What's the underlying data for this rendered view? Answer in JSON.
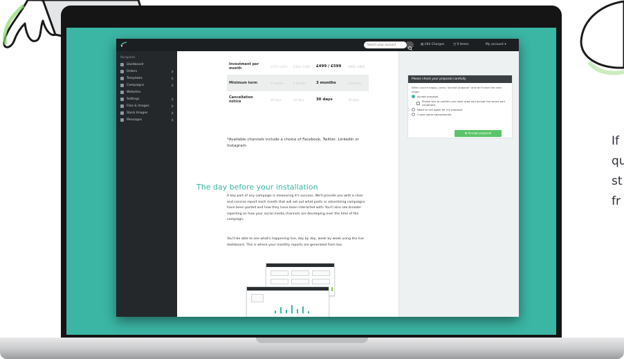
{
  "topbar": {
    "search_placeholder": "Search your account",
    "links": [
      "£94 Charges",
      "0 Items",
      "My account"
    ]
  },
  "sidebar": {
    "heading": "Navigation",
    "items": [
      {
        "label": "Dashboard",
        "has_submenu": false
      },
      {
        "label": "Orders",
        "has_submenu": true
      },
      {
        "label": "Templates",
        "has_submenu": true
      },
      {
        "label": "Campaigns",
        "has_submenu": true
      },
      {
        "label": "Websites",
        "has_submenu": false
      },
      {
        "label": "Settings",
        "has_submenu": true
      },
      {
        "label": "Files & Images",
        "has_submenu": true
      },
      {
        "label": "Stock Images",
        "has_submenu": true
      },
      {
        "label": "Messages",
        "has_submenu": true
      }
    ]
  },
  "pricing_table": {
    "rows": [
      {
        "label": "Investment per month",
        "cells": [
          "£175 / £225",
          "£350 / £450",
          "£499 / £599",
          "£600 / £800"
        ]
      },
      {
        "label": "Minimum term",
        "cells": [
          "3 months",
          "3 months",
          "3 months",
          "3 months"
        ]
      },
      {
        "label": "Cancellation notice",
        "cells": [
          "30 days",
          "30 days",
          "30 days",
          "30 days"
        ]
      }
    ],
    "highlight_column": 2,
    "note": "*Available channels include a choice of Facebook, Twitter, LinkedIn or Instagram"
  },
  "section": {
    "title": "The day before your installation",
    "paragraph_1": "A key part of any campaign is measuring it's success. We'll provide you with a clear and concise report each month that will set out what posts or advertising campaigns have been posted and how they have been interacted with. You'll also see broader reporting on how your social media channels are developing over the time of the campaign.",
    "paragraph_2": "You'll be able to see what's happening live, day by day, week by week using the live dashboard. This is where your monthly reports are generated from too."
  },
  "form": {
    "heading": "Please check your proposal carefully",
    "intro": "When you're happy, press \"Accept proposal\" and we'll start the next stage.",
    "options": [
      {
        "label": "Accept proposal",
        "type": "radio",
        "selected": true,
        "indent": false
      },
      {
        "label": "Please tick to confirm you have read and accept the terms and conditions",
        "type": "checkbox",
        "selected": false,
        "indent": true
      },
      {
        "label": "Need to call again for my proposal",
        "type": "radio",
        "selected": false,
        "indent": false
      },
      {
        "label": "I have some amendments",
        "type": "radio",
        "selected": false,
        "indent": false
      }
    ],
    "submit_label": "Accept proposal"
  },
  "side_text": [
    "If",
    "qu",
    "st",
    "fr"
  ],
  "colors": {
    "accent": "#3bb5a4",
    "submit": "#5cc46a",
    "topbar": "#1c1f22",
    "sidebar": "#24282b",
    "panel": "#eef1f2"
  }
}
